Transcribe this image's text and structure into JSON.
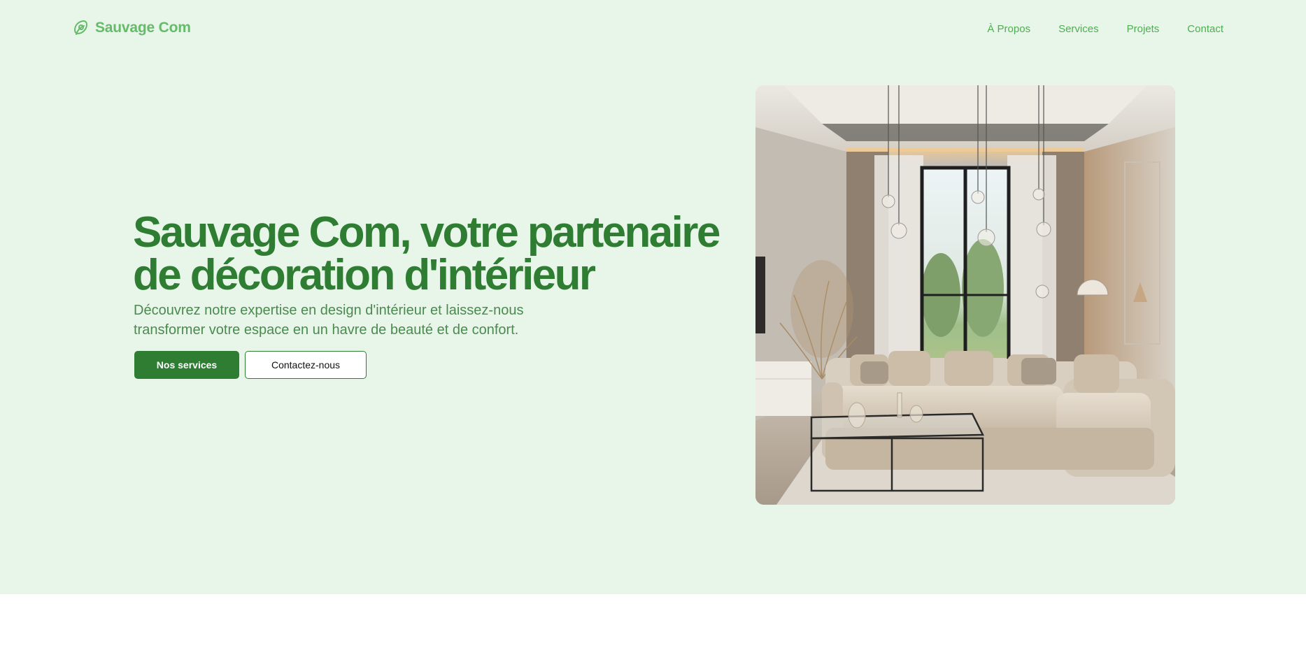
{
  "header": {
    "brand_name": "Sauvage Com",
    "brand_icon": "leaf-icon",
    "nav": [
      {
        "label": "À Propos"
      },
      {
        "label": "Services"
      },
      {
        "label": "Projets"
      },
      {
        "label": "Contact"
      }
    ]
  },
  "hero": {
    "title_line1": "Sauvage Com, votre partenaire",
    "title_line2": "de décoration d'intérieur",
    "description_line1": "Découvrez notre expertise en design d'intérieur et laissez-nous",
    "description_line2": "transformer votre espace en un havre de beauté et de confort.",
    "primary_button": "Nos services",
    "secondary_button": "Contactez-nous"
  },
  "colors": {
    "hero_background": "#e8f5e9",
    "brand_green": "#2e7d32",
    "link_green": "#4caf50",
    "page_background": "#ffffff"
  }
}
